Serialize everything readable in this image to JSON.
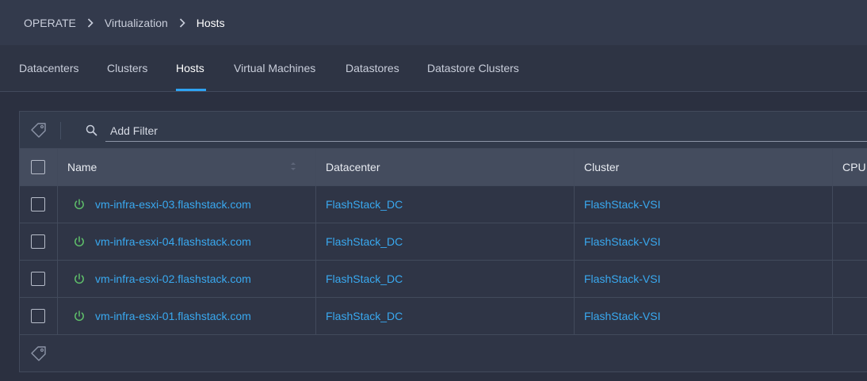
{
  "breadcrumb": [
    "OPERATE",
    "Virtualization",
    "Hosts"
  ],
  "tabs": [
    {
      "label": "Datacenters",
      "active": false
    },
    {
      "label": "Clusters",
      "active": false
    },
    {
      "label": "Hosts",
      "active": true
    },
    {
      "label": "Virtual Machines",
      "active": false
    },
    {
      "label": "Datastores",
      "active": false
    },
    {
      "label": "Datastore Clusters",
      "active": false
    }
  ],
  "filter": {
    "placeholder": "Add Filter"
  },
  "table": {
    "columns": [
      "Name",
      "Datacenter",
      "Cluster",
      "CPU"
    ],
    "rows": [
      {
        "name": "vm-infra-esxi-03.flashstack.com",
        "datacenter": "FlashStack_DC",
        "cluster": "FlashStack-VSI",
        "cpu": ""
      },
      {
        "name": "vm-infra-esxi-04.flashstack.com",
        "datacenter": "FlashStack_DC",
        "cluster": "FlashStack-VSI",
        "cpu": ""
      },
      {
        "name": "vm-infra-esxi-02.flashstack.com",
        "datacenter": "FlashStack_DC",
        "cluster": "FlashStack-VSI",
        "cpu": ""
      },
      {
        "name": "vm-infra-esxi-01.flashstack.com",
        "datacenter": "FlashStack_DC",
        "cluster": "FlashStack-VSI",
        "cpu": ""
      }
    ]
  },
  "colors": {
    "accent": "#2ea3f2",
    "link": "#39a9f0",
    "power_on": "#5fbf6a"
  },
  "icons": {
    "breadcrumb_separator": "chevron-right-icon",
    "tag": "tag-icon",
    "search": "search-icon",
    "sort": "sort-icon",
    "status": "power-icon"
  }
}
